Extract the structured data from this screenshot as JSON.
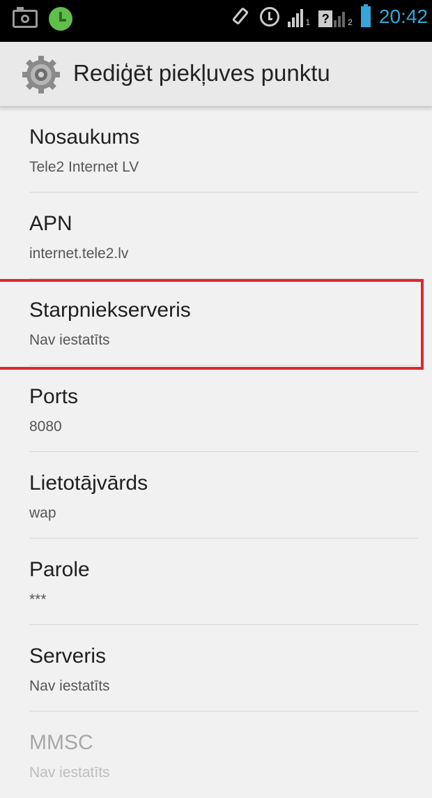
{
  "status_bar": {
    "time": "20:42",
    "sim1_indicator": "1",
    "sim2_indicator": "2",
    "icons": [
      "camera-icon",
      "clock-app-icon",
      "vibrate-icon",
      "alarm-icon",
      "signal-3g-icon",
      "signal-no-sim-icon",
      "battery-icon"
    ]
  },
  "action_bar": {
    "title": "Rediģēt piekļuves punktu",
    "icon": "settings-gear-icon"
  },
  "preferences": [
    {
      "title": "Nosaukums",
      "summary": "Tele2 Internet LV"
    },
    {
      "title": "APN",
      "summary": "internet.tele2.lv"
    },
    {
      "title": "Starpniekserveris",
      "summary": "Nav iestatīts"
    },
    {
      "title": "Ports",
      "summary": "8080"
    },
    {
      "title": "Lietotājvārds",
      "summary": "wap"
    },
    {
      "title": "Parole",
      "summary": "***"
    },
    {
      "title": "Serveris",
      "summary": "Nav iestatīts"
    },
    {
      "title": "MMSC",
      "summary": "Nav iestatīts"
    }
  ],
  "colors": {
    "accent": "#35a6d8",
    "highlight_border": "#e0262b",
    "background": "#f1f1f1"
  }
}
